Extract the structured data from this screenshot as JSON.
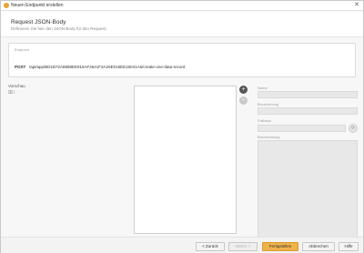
{
  "window": {
    "title": "Neuen Endpunkt erstellen",
    "close_glyph": "✕",
    "icon": "app-icon"
  },
  "header": {
    "title": "Request JSON-Body",
    "subtitle": "Definieren Sie hier den JSON-Body für den Request."
  },
  "endpoint": {
    "label": "Endpoint",
    "method": "POST",
    "url": "/api/app/BD1B72A8888EE915AF4641F3A25E015EE16041A6/create-one-data-record"
  },
  "preview": {
    "label": "Vorschau",
    "tree": [
      {
        "key": "{",
        "sep": "}"
      }
    ]
  },
  "actions": {
    "add_glyph": "+",
    "remove_glyph": "−"
  },
  "fields": {
    "name_label": "Name",
    "name_value": "",
    "bezeichnung_label": "Bezeichnung",
    "bezeichnung_value": "",
    "fallback_label": "Fallback",
    "fallback_value": "",
    "fallback_button_glyph": "⟳",
    "beschreibung_label": "Beschreibung",
    "beschreibung_value": ""
  },
  "footer": {
    "back": "< Zurück",
    "next": "Weiter >",
    "finish": "Fertigstellen",
    "cancel": "Abbrechen",
    "help": "Hilfe"
  },
  "colors": {
    "primary": "#f0b24a",
    "app_icon": "#e8a33a",
    "add_button": "#555555"
  }
}
